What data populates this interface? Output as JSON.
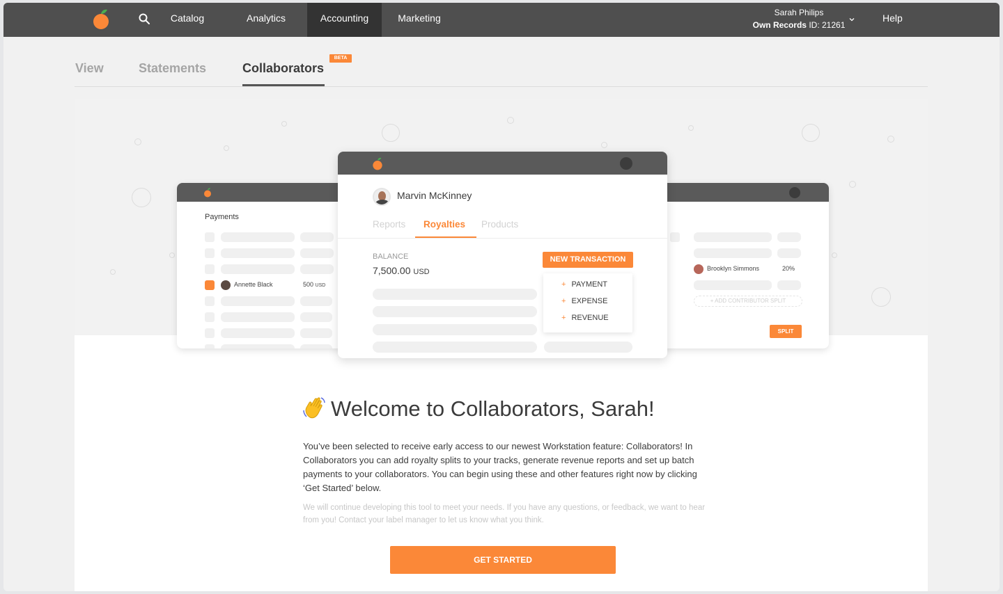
{
  "nav": {
    "items": [
      "Catalog",
      "Analytics",
      "Accounting",
      "Marketing"
    ],
    "active": "Accounting",
    "user_name": "Sarah Philips",
    "records_label": "Own Records",
    "records_id": "ID: 21261",
    "help": "Help"
  },
  "tabs": {
    "view": "View",
    "statements": "Statements",
    "collaborators": "Collaborators",
    "beta": "BETA"
  },
  "mock": {
    "left": {
      "title": "Payments",
      "name": "Annette Black",
      "amount": "500",
      "currency": "USD"
    },
    "center": {
      "name": "Marvin McKinney",
      "tabs": [
        "Reports",
        "Royalties",
        "Products"
      ],
      "balance_label": "BALANCE",
      "balance_value": "7,500.00",
      "balance_currency": "USD",
      "new_transaction": "NEW TRANSACTION",
      "menu": [
        "PAYMENT",
        "EXPENSE",
        "REVENUE"
      ]
    },
    "right": {
      "name": "Brooklyn Simmons",
      "percent": "20%",
      "add_split": "+ ADD CONTRIBUTOR SPLIT",
      "split": "SPLIT"
    }
  },
  "welcome": {
    "title": "Welcome to Collaborators, Sarah!",
    "body": "You’ve been selected to receive early access to our newest Workstation feature: Collaborators! In Collaborators you can add royalty splits to your tracks, generate revenue reports and set up batch payments to your collaborators. You can begin using these and other features right now by clicking ‘Get Started’ below.",
    "note": "We will continue developing this tool to meet your needs. If you have any questions, or feedback, we want to hear from you! Contact your label manager to let us know what you think.",
    "cta": "GET STARTED"
  },
  "colors": {
    "accent": "#fb8838",
    "nav_bg": "#4f4f4f",
    "nav_active": "#333333"
  }
}
